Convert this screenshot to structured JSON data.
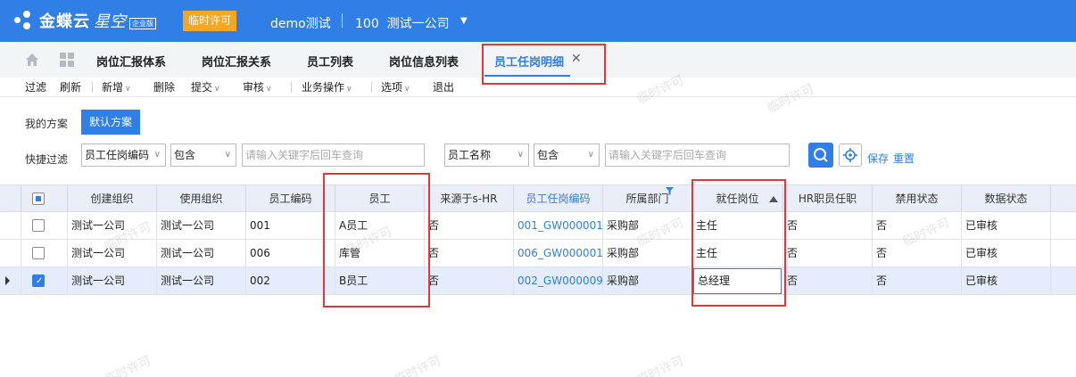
{
  "app": {
    "brand": "金蝶云",
    "product": "星空",
    "edition": "企业版",
    "license_badge": "临时许可",
    "user": "demo测试",
    "org_code": "100",
    "org_name": "测试一公司"
  },
  "tabs": [
    {
      "label": "岗位汇报体系"
    },
    {
      "label": "岗位汇报关系"
    },
    {
      "label": "员工列表"
    },
    {
      "label": "岗位信息列表"
    },
    {
      "label": "员工任岗明细",
      "active": true
    }
  ],
  "toolbar": {
    "filter": "过滤",
    "refresh": "刷新",
    "add": "新增",
    "delete": "删除",
    "submit": "提交",
    "audit": "审核",
    "business": "业务操作",
    "options": "选项",
    "exit": "退出"
  },
  "scheme": {
    "label": "我的方案",
    "default": "默认方案"
  },
  "quick_filter": {
    "label": "快捷过滤",
    "field1": "员工任岗编码",
    "op1": "包含",
    "placeholder1": "请输入关键字后回车查询",
    "field2": "员工名称",
    "op2": "包含",
    "placeholder2": "请输入关键字后回车查询",
    "save": "保存",
    "reset": "重置"
  },
  "grid": {
    "columns": [
      "创建组织",
      "使用组织",
      "员工编码",
      "员工",
      "来源于s-HR",
      "员工任岗编码",
      "所属部门",
      "就任岗位",
      "HR职员任职",
      "禁用状态",
      "数据状态"
    ],
    "rows": [
      {
        "create_org": "测试一公司",
        "use_org": "测试一公司",
        "emp_code": "001",
        "employee": "A员工",
        "from_shr": "否",
        "assign_code": "001_GW000001_",
        "dept": "采购部",
        "post": "主任",
        "hr_post": "否",
        "disabled": "否",
        "status": "已审核",
        "checked": false
      },
      {
        "create_org": "测试一公司",
        "use_org": "测试一公司",
        "emp_code": "006",
        "employee": "库管",
        "from_shr": "否",
        "assign_code": "006_GW000001_",
        "dept": "采购部",
        "post": "主任",
        "hr_post": "否",
        "disabled": "否",
        "status": "已审核",
        "checked": false
      },
      {
        "create_org": "测试一公司",
        "use_org": "测试一公司",
        "emp_code": "002",
        "employee": "B员工",
        "from_shr": "否",
        "assign_code": "002_GW000009_",
        "dept": "采购部",
        "post": "总经理",
        "hr_post": "否",
        "disabled": "否",
        "status": "已审核",
        "checked": true
      }
    ]
  },
  "watermark": "临时许可",
  "colors": {
    "topbar": "#2f7fe6",
    "accent": "#2f7fe6",
    "license": "#f5a623",
    "highlight": "#e0393a"
  }
}
